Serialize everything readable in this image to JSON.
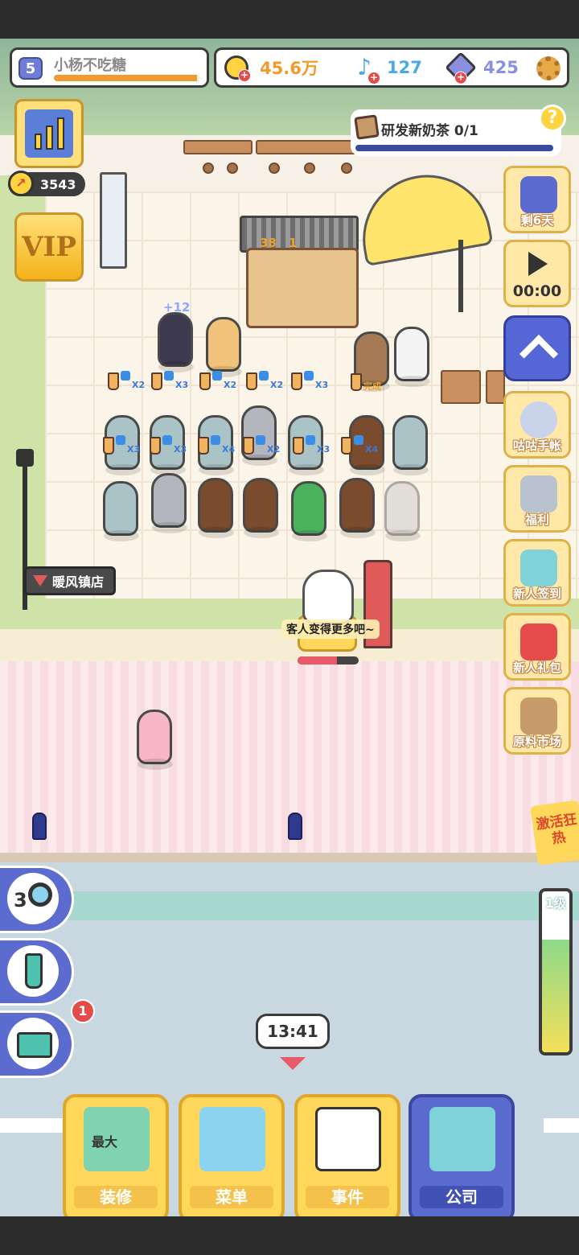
{
  "player": {
    "level": "5",
    "name": "小杨不吃糖",
    "xp_progress": 0.98
  },
  "currency": {
    "coins": "45.6万",
    "notes": "127",
    "gems": "425",
    "coin_color": "#f29a2e",
    "note_color": "#4aa9e8",
    "gem_color": "#8b8fe0"
  },
  "power": {
    "value": "3543"
  },
  "vip": {
    "label": "VIP"
  },
  "task": {
    "text": "研发新奶茶 0/1",
    "progress": 0
  },
  "help": {
    "glyph": "?"
  },
  "side_menu": {
    "days_left": "剩6天",
    "video_timer": "00:00",
    "items": [
      {
        "label": "咕咕手帐",
        "icon": "pigeon-icon"
      },
      {
        "label": "福利",
        "icon": "welfare-cat-icon"
      },
      {
        "label": "新人签到",
        "icon": "calendar-icon"
      },
      {
        "label": "新人礼包",
        "icon": "gift-icon"
      },
      {
        "label": "原料市场",
        "icon": "market-icon"
      }
    ]
  },
  "store": {
    "name": "暖风镇店"
  },
  "scene": {
    "stand_count": "38",
    "stand_count2": "1",
    "bonus_popup": "+12",
    "done_label": "完成",
    "hint_text": "客人变得更多吧~",
    "hint_progress": 0.65,
    "queue_row1": [
      "X2",
      "X3",
      "X2",
      "X2",
      "X3"
    ],
    "queue_row2": [
      "X3",
      "X3",
      "X4",
      "X2",
      "X3",
      "X4"
    ]
  },
  "hot": {
    "banner": "激活狂热",
    "level": "1级",
    "fill": 0.7
  },
  "left_tools": {
    "search_count": "3",
    "box_badge": "1"
  },
  "timer": {
    "time": "13:41"
  },
  "nav": {
    "decor_art_label": "最大",
    "items": [
      {
        "label": "装修",
        "icon": "paint-roller-icon"
      },
      {
        "label": "菜单",
        "icon": "menu-list-icon"
      },
      {
        "label": "事件",
        "icon": "event-calendar-icon"
      },
      {
        "label": "公司",
        "icon": "cash-register-icon"
      }
    ]
  }
}
